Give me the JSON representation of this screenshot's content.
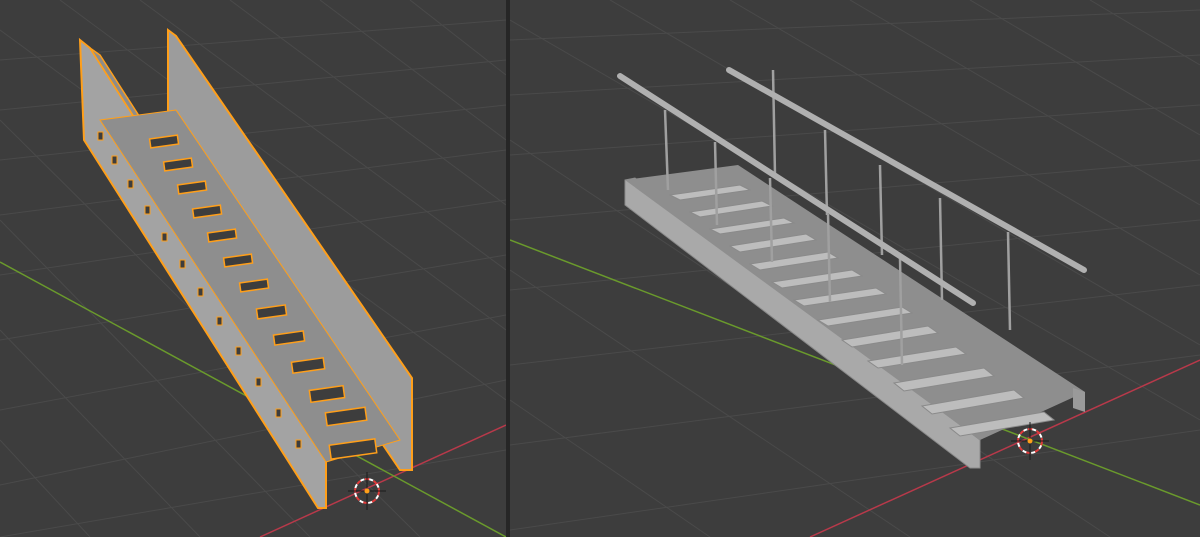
{
  "viewports": [
    {
      "id": "viewport-left",
      "mode": "edit",
      "selection_color": "#ff9f1a"
    },
    {
      "id": "viewport-right",
      "mode": "object",
      "selection_color": null
    }
  ],
  "colors": {
    "background": "#3d3d3d",
    "grid_line": "#4a4a4a",
    "x_axis": "#b8394a",
    "y_axis": "#6a9a2c",
    "mesh_fill": "#9c9c9c",
    "mesh_dark": "#6e6e6e",
    "selection": "#ff9f1a",
    "cursor_red": "#e23b3b",
    "cursor_white": "#ffffff"
  },
  "icons": [
    "3d-cursor-icon",
    "origin-dot-icon"
  ]
}
